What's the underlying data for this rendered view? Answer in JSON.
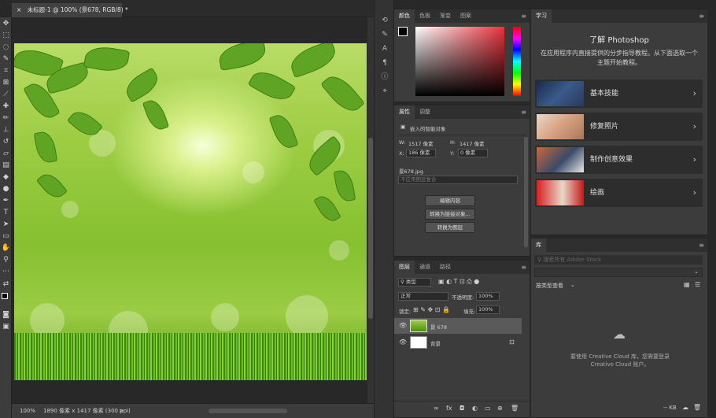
{
  "document": {
    "tab_close": "×",
    "tab_title": "未标题-1 @ 100% (景678, RGB/8) *"
  },
  "status": {
    "zoom": "100%",
    "info": "1890 像素 x 1417 像素 (300 ppi)",
    "arrow": ">"
  },
  "color_panel": {
    "tabs": [
      "颜色",
      "色板",
      "渐变",
      "图案"
    ],
    "hue": "#e8323c"
  },
  "properties_panel": {
    "tabs": [
      "属性",
      "调整"
    ],
    "type": "嵌入的智能对象",
    "w_label": "W:",
    "w_value": "1517 像素",
    "h_label": "H:",
    "h_value": "1417 像素",
    "x_label": "X:",
    "x_value": "186 像素",
    "y_label": "Y:",
    "y_value": "0 像素",
    "file_name": "景678.jpg",
    "comp_placeholder": "不应用图层复合",
    "buttons": [
      "编辑内容",
      "转换为链接对象...",
      "转换为图层"
    ]
  },
  "layers_panel": {
    "tabs": [
      "图层",
      "通道",
      "路径"
    ],
    "filter_kind": "类型",
    "blend_mode": "正常",
    "opacity_label": "不透明度:",
    "opacity_value": "100%",
    "lock_label": "锁定:",
    "fill_label": "填充:",
    "fill_value": "100%",
    "layers": [
      {
        "name": "景 678",
        "selected": true
      },
      {
        "name": "背景",
        "selected": false
      }
    ]
  },
  "learn_panel": {
    "tab": "学习",
    "title": "了解 Photoshop",
    "desc": "在应用程序内直接提供的分步指导教程。从下面选取一个主题开始教程。",
    "items": [
      "基本技能",
      "修复照片",
      "制作创意效果",
      "绘画"
    ]
  },
  "library_panel": {
    "tab": "库",
    "search_placeholder": "搜索所有 Adobe Stock",
    "view_label": "按类型查看",
    "message": "要使用 Creative Cloud 库，您需要登录 Creative Cloud 账户。",
    "kb": "-- KB"
  }
}
